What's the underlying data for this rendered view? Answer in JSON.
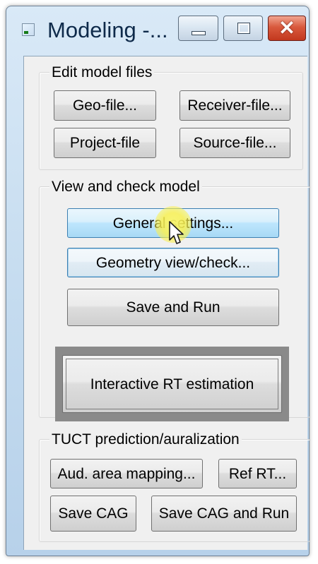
{
  "window": {
    "title": "Modeling -...",
    "minimize_icon": "minimize-icon",
    "maximize_icon": "maximize-icon",
    "close_icon": "close-icon",
    "close_glyph": "✕",
    "accent_color": "#3c7fb1",
    "close_color": "#c2381e"
  },
  "edit_model_files": {
    "legend": "Edit model files",
    "geo_button": "Geo-file...",
    "receiver_button": "Receiver-file...",
    "project_button": "Project-file",
    "source_button": "Source-file..."
  },
  "view_check_model": {
    "legend": "View and check model",
    "general_settings_button": "General settings...",
    "geometry_button": "Geometry view/check...",
    "save_run_button": "Save and Run",
    "interactive_rt_button": "Interactive RT estimation"
  },
  "tuct": {
    "legend": "TUCT prediction/auralization",
    "aud_area_button": "Aud. area mapping...",
    "ref_rt_button": "Ref RT...",
    "save_cag_button": "Save CAG",
    "save_cag_run_button": "Save CAG and Run"
  },
  "cursor": {
    "icon": "arrow-cursor-icon",
    "highlight_color": "#f8f06a"
  }
}
